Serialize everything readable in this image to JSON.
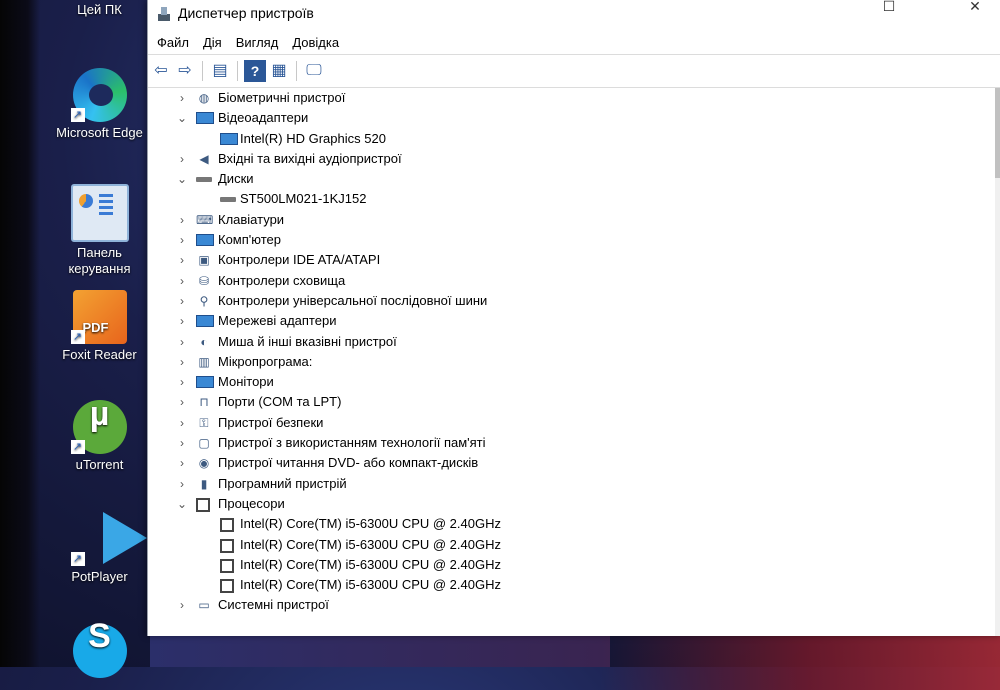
{
  "desktop": {
    "icons": [
      {
        "label": "Цей ПК"
      },
      {
        "label": "Microsoft Edge"
      },
      {
        "label": "Панель керування"
      },
      {
        "label": "Foxit Reader",
        "badge": "PDF"
      },
      {
        "label": "uTorrent",
        "glyph": "µ"
      },
      {
        "label": "PotPlayer"
      },
      {
        "label": "",
        "glyph": "S"
      }
    ]
  },
  "window": {
    "title": "Диспетчер пристроїв",
    "controls": {
      "minimize": "—",
      "maximize": "☐",
      "close": "✕"
    },
    "menu": [
      "Файл",
      "Дія",
      "Вигляд",
      "Довідка"
    ],
    "toolbar": [
      "back-arrow-icon",
      "forward-arrow-icon",
      "properties-icon",
      "help-icon",
      "details-icon",
      "scan-monitor-icon"
    ]
  },
  "tree": [
    {
      "level": 0,
      "expanded": false,
      "label": "Біометричні пристрої",
      "icon": "fingerprint-icon"
    },
    {
      "level": 0,
      "expanded": true,
      "label": "Відеоадаптери",
      "icon": "display-adapter-icon"
    },
    {
      "level": 1,
      "label": "Intel(R) HD Graphics 520",
      "icon": "display-adapter-icon"
    },
    {
      "level": 0,
      "expanded": false,
      "label": "Вхідні та вихідні аудіопристрої",
      "icon": "speaker-icon"
    },
    {
      "level": 0,
      "expanded": true,
      "label": "Диски",
      "icon": "disk-drive-icon"
    },
    {
      "level": 1,
      "label": "ST500LM021-1KJ152",
      "icon": "disk-drive-icon"
    },
    {
      "level": 0,
      "expanded": false,
      "label": "Клавіатури",
      "icon": "keyboard-icon"
    },
    {
      "level": 0,
      "expanded": false,
      "label": "Комп'ютер",
      "icon": "computer-icon"
    },
    {
      "level": 0,
      "expanded": false,
      "label": "Контролери IDE ATA/ATAPI",
      "icon": "ide-controller-icon"
    },
    {
      "level": 0,
      "expanded": false,
      "label": "Контролери сховища",
      "icon": "storage-controller-icon"
    },
    {
      "level": 0,
      "expanded": false,
      "label": "Контролери універсальної послідовної шини",
      "icon": "usb-icon"
    },
    {
      "level": 0,
      "expanded": false,
      "label": "Мережеві адаптери",
      "icon": "network-adapter-icon"
    },
    {
      "level": 0,
      "expanded": false,
      "label": "Миша й інші вказівні пристрої",
      "icon": "mouse-icon"
    },
    {
      "level": 0,
      "expanded": false,
      "label": "Мікропрограма:",
      "icon": "firmware-icon"
    },
    {
      "level": 0,
      "expanded": false,
      "label": "Монітори",
      "icon": "monitor-icon"
    },
    {
      "level": 0,
      "expanded": false,
      "label": "Порти (COM та LPT)",
      "icon": "port-icon"
    },
    {
      "level": 0,
      "expanded": false,
      "label": "Пристрої безпеки",
      "icon": "security-key-icon"
    },
    {
      "level": 0,
      "expanded": false,
      "label": "Пристрої з використанням технології пам'яті",
      "icon": "memory-tech-icon"
    },
    {
      "level": 0,
      "expanded": false,
      "label": "Пристрої читання DVD- або компакт-дисків",
      "icon": "dvd-drive-icon"
    },
    {
      "level": 0,
      "expanded": false,
      "label": "Програмний пристрій",
      "icon": "software-device-icon"
    },
    {
      "level": 0,
      "expanded": true,
      "label": "Процесори",
      "icon": "processor-icon"
    },
    {
      "level": 1,
      "label": "Intel(R) Core(TM) i5-6300U CPU @ 2.40GHz",
      "icon": "processor-icon"
    },
    {
      "level": 1,
      "label": "Intel(R) Core(TM) i5-6300U CPU @ 2.40GHz",
      "icon": "processor-icon"
    },
    {
      "level": 1,
      "label": "Intel(R) Core(TM) i5-6300U CPU @ 2.40GHz",
      "icon": "processor-icon"
    },
    {
      "level": 1,
      "label": "Intel(R) Core(TM) i5-6300U CPU @ 2.40GHz",
      "icon": "processor-icon"
    },
    {
      "level": 0,
      "expanded": false,
      "label": "Системні пристрої",
      "icon": "system-device-icon"
    }
  ]
}
